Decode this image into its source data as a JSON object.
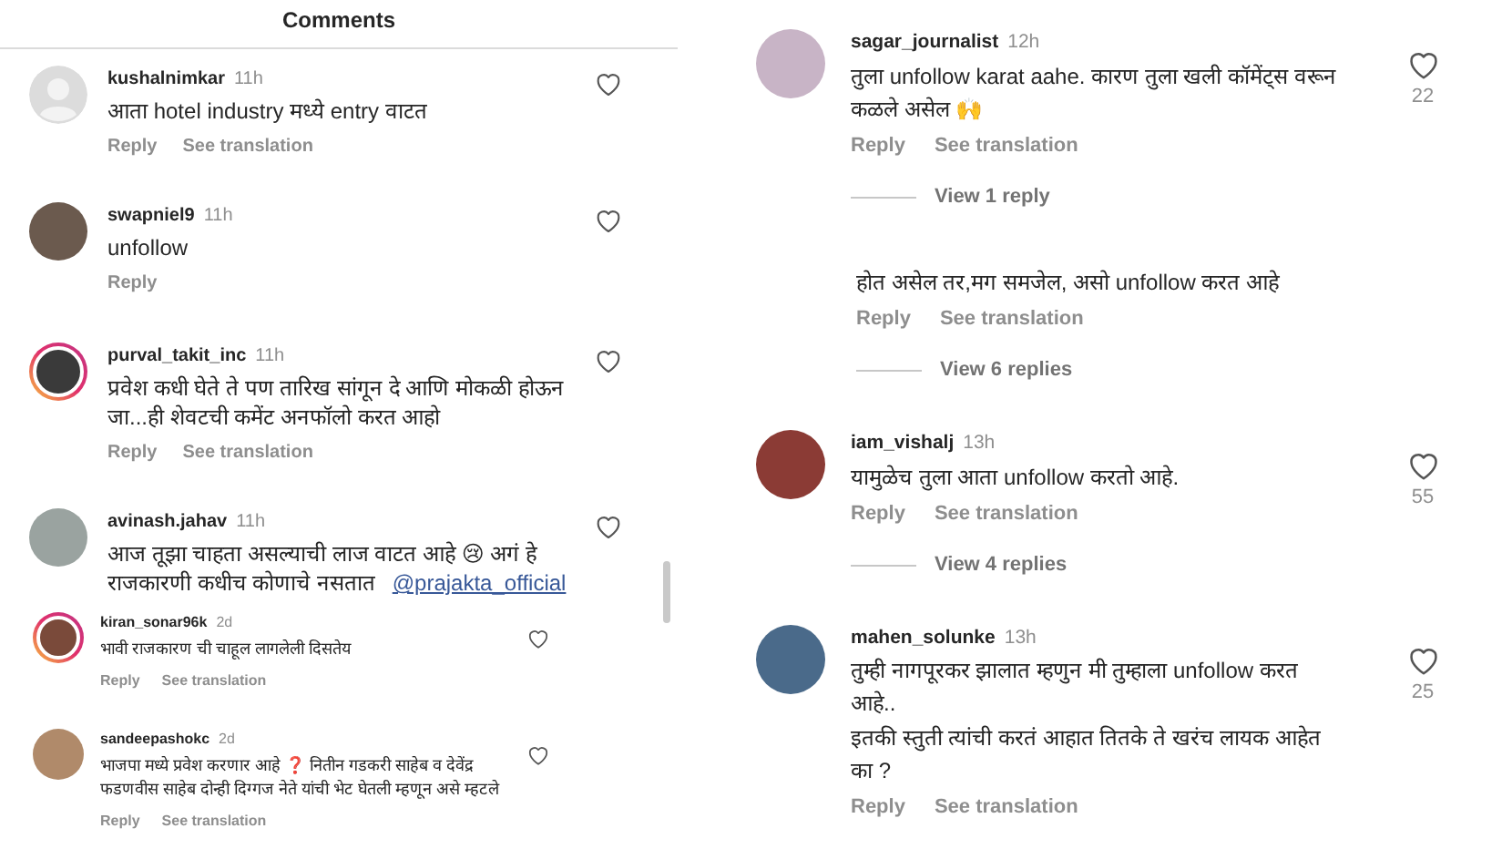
{
  "left_panel": {
    "title": "Comments",
    "comments": [
      {
        "kind": "regular",
        "photo": false,
        "story_ring": false,
        "username": "kushalnimkar",
        "time": "11h",
        "text": "आता hotel industry मध्ये entry वाटत",
        "actions": [
          "Reply",
          "See translation"
        ]
      },
      {
        "kind": "regular",
        "photo": true,
        "story_ring": false,
        "username": "swapniel9",
        "time": "11h",
        "text": "unfollow",
        "actions": [
          "Reply"
        ]
      },
      {
        "kind": "regular",
        "photo": true,
        "story_ring": true,
        "username": "purval_takit_inc",
        "time": "11h",
        "text": "प्रवेश कधी घेते ते पण तारिख सांगून दे आणि मोकळी होऊन जा...ही शेवटची कमेंट अनफॉलो करत आहो",
        "actions": [
          "Reply",
          "See translation"
        ]
      },
      {
        "kind": "regular",
        "photo": true,
        "story_ring": false,
        "username": "avinash.jahav",
        "time": "11h",
        "text": "आज तूझा चाहता असल्याची लाज वाटत आहे 😢 अगं हे राजकारणी कधीच कोणाचे नसतात",
        "mention": "@prajakta_official"
      },
      {
        "kind": "compact",
        "photo": true,
        "story_ring": true,
        "username": "kiran_sonar96k",
        "time": "2d",
        "text": "भावी राजकारण ची चाहूल लागलेली दिसतेय",
        "actions": [
          "Reply",
          "See translation"
        ]
      },
      {
        "kind": "compact",
        "photo": true,
        "story_ring": false,
        "username": "sandeepashokc",
        "time": "2d",
        "text": "भाजपा मध्ये प्रवेश करणार आहे ❓ नितीन गडकरी साहेब व देवेंद्र फडणवीस साहेब दोन्ही दिग्गज नेते यांची भेट घेतली म्हणून असे म्हटले",
        "actions": [
          "Reply",
          "See translation"
        ]
      }
    ]
  },
  "right_panel": {
    "comments": [
      {
        "kind": "large",
        "photo": true,
        "story_ring": false,
        "username": "sagar_journalist",
        "time": "12h",
        "text": "तुला unfollow karat aahe. कारण तुला खली कॉमेंट्स वरून कळले असेल 🙌",
        "likes": "22",
        "actions": [
          "Reply",
          "See translation"
        ],
        "view_replies": "View 1 reply"
      },
      {
        "kind": "fragment",
        "text": "होत असेल तर,मग समजेल, असो unfollow करत आहे",
        "actions": [
          "Reply",
          "See translation"
        ],
        "view_replies": "View 6 replies"
      },
      {
        "kind": "large",
        "photo": true,
        "story_ring": false,
        "username": "iam_vishalj",
        "time": "13h",
        "text": "यामुळेच तुला आता unfollow करतो आहे.",
        "likes": "55",
        "actions": [
          "Reply",
          "See translation"
        ],
        "view_replies": "View 4 replies"
      },
      {
        "kind": "large",
        "photo": true,
        "story_ring": false,
        "username": "mahen_solunke",
        "time": "13h",
        "text": "तुम्ही नागपूरकर झालात म्हणुन मी तुम्हाला unfollow करत आहे..\nइतकी स्तुती त्यांची करतं आहात तितके ते खरंच लायक आहेत का ?",
        "likes": "25",
        "actions": [
          "Reply",
          "See translation"
        ]
      }
    ]
  }
}
